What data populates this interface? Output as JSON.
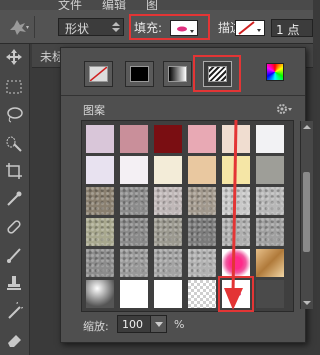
{
  "menubar": {
    "items": [
      "文件",
      "编辑",
      "图"
    ]
  },
  "options": {
    "shape_mode": "形状",
    "fill_label": "填充:",
    "stroke_label": "描边:",
    "stroke_width": "1 点"
  },
  "doc_tab": {
    "title": "未标"
  },
  "fill_panel": {
    "fill_types": [
      "no-fill",
      "solid-color",
      "gradient",
      "pattern",
      "color-picker"
    ],
    "selected_type": "pattern",
    "section_title": "图案",
    "scale_label": "缩放:",
    "scale_value": "100",
    "scale_unit": "%",
    "scroll_position_fraction": 0.47
  },
  "patterns": [
    {
      "name": "pattern-1",
      "color": "#d9c6d9",
      "selected": false
    },
    {
      "name": "pattern-2",
      "color": "#c98f9a",
      "selected": false
    },
    {
      "name": "pattern-3",
      "color": "#7a0e12",
      "selected": false
    },
    {
      "name": "pattern-4",
      "color": "#e8a9b4",
      "selected": false
    },
    {
      "name": "pattern-5",
      "color": "#f0ddd0",
      "selected": false
    },
    {
      "name": "pattern-6",
      "color": "#f2f2f4",
      "selected": false
    },
    {
      "name": "pattern-7",
      "color": "#e8e2f0",
      "selected": false
    },
    {
      "name": "pattern-8",
      "color": "#f4f0f4",
      "selected": false
    },
    {
      "name": "pattern-9",
      "color": "#f3ecd8",
      "selected": false
    },
    {
      "name": "pattern-10",
      "color": "#e9c8a0",
      "selected": false
    },
    {
      "name": "pattern-11",
      "color": "#f5e6a6",
      "selected": false
    },
    {
      "name": "pattern-12",
      "color": "#9e9e98",
      "selected": false
    },
    {
      "name": "pattern-13",
      "color": "#8a8070",
      "selected": false
    },
    {
      "name": "pattern-14",
      "color": "#8c8c8c",
      "selected": false
    },
    {
      "name": "pattern-15",
      "color": "#c0b8b8",
      "selected": false
    },
    {
      "name": "pattern-16",
      "color": "#a39a8e",
      "selected": false
    },
    {
      "name": "pattern-17",
      "color": "#c9c9c9",
      "selected": false
    },
    {
      "name": "pattern-18",
      "color": "#b8b8b8",
      "selected": false
    },
    {
      "name": "pattern-19",
      "color": "#a8a88e",
      "selected": false
    },
    {
      "name": "pattern-20",
      "color": "#8a8a8a",
      "selected": false
    },
    {
      "name": "pattern-21",
      "color": "#9c9a90",
      "selected": false
    },
    {
      "name": "pattern-22",
      "color": "#7c7c7c",
      "selected": false
    },
    {
      "name": "pattern-23",
      "color": "#b0b0b0",
      "selected": false
    },
    {
      "name": "pattern-24",
      "color": "#a0a0a0",
      "selected": false
    },
    {
      "name": "pattern-25",
      "color": "#8c8c8c",
      "selected": false
    },
    {
      "name": "pattern-26",
      "color": "#9a9a9a",
      "selected": false
    },
    {
      "name": "pattern-27",
      "color": "#a4a4a4",
      "selected": false
    },
    {
      "name": "pattern-28",
      "color": "#b2b2b2",
      "selected": false
    },
    {
      "name": "pattern-29",
      "color": "#ec1f7a",
      "selected": false
    },
    {
      "name": "pattern-30",
      "color": "#caa46a",
      "selected": false
    },
    {
      "name": "pattern-31",
      "color": "#8a8a8a",
      "selected": false
    },
    {
      "name": "pattern-32",
      "color": "#ffffff",
      "selected": false
    },
    {
      "name": "pattern-33",
      "color": "#ffffff",
      "selected": false
    },
    {
      "name": "pattern-34",
      "color": "#d0d0d0",
      "selected": false
    },
    {
      "name": "pattern-35",
      "color": "#ffffff",
      "selected": true
    },
    {
      "name": "pattern-36",
      "color": "#4a4a4a",
      "selected": false
    }
  ],
  "colors": {
    "highlight": "#e33535",
    "panel_bg": "#4f4f4f",
    "options_bg": "#535353"
  }
}
